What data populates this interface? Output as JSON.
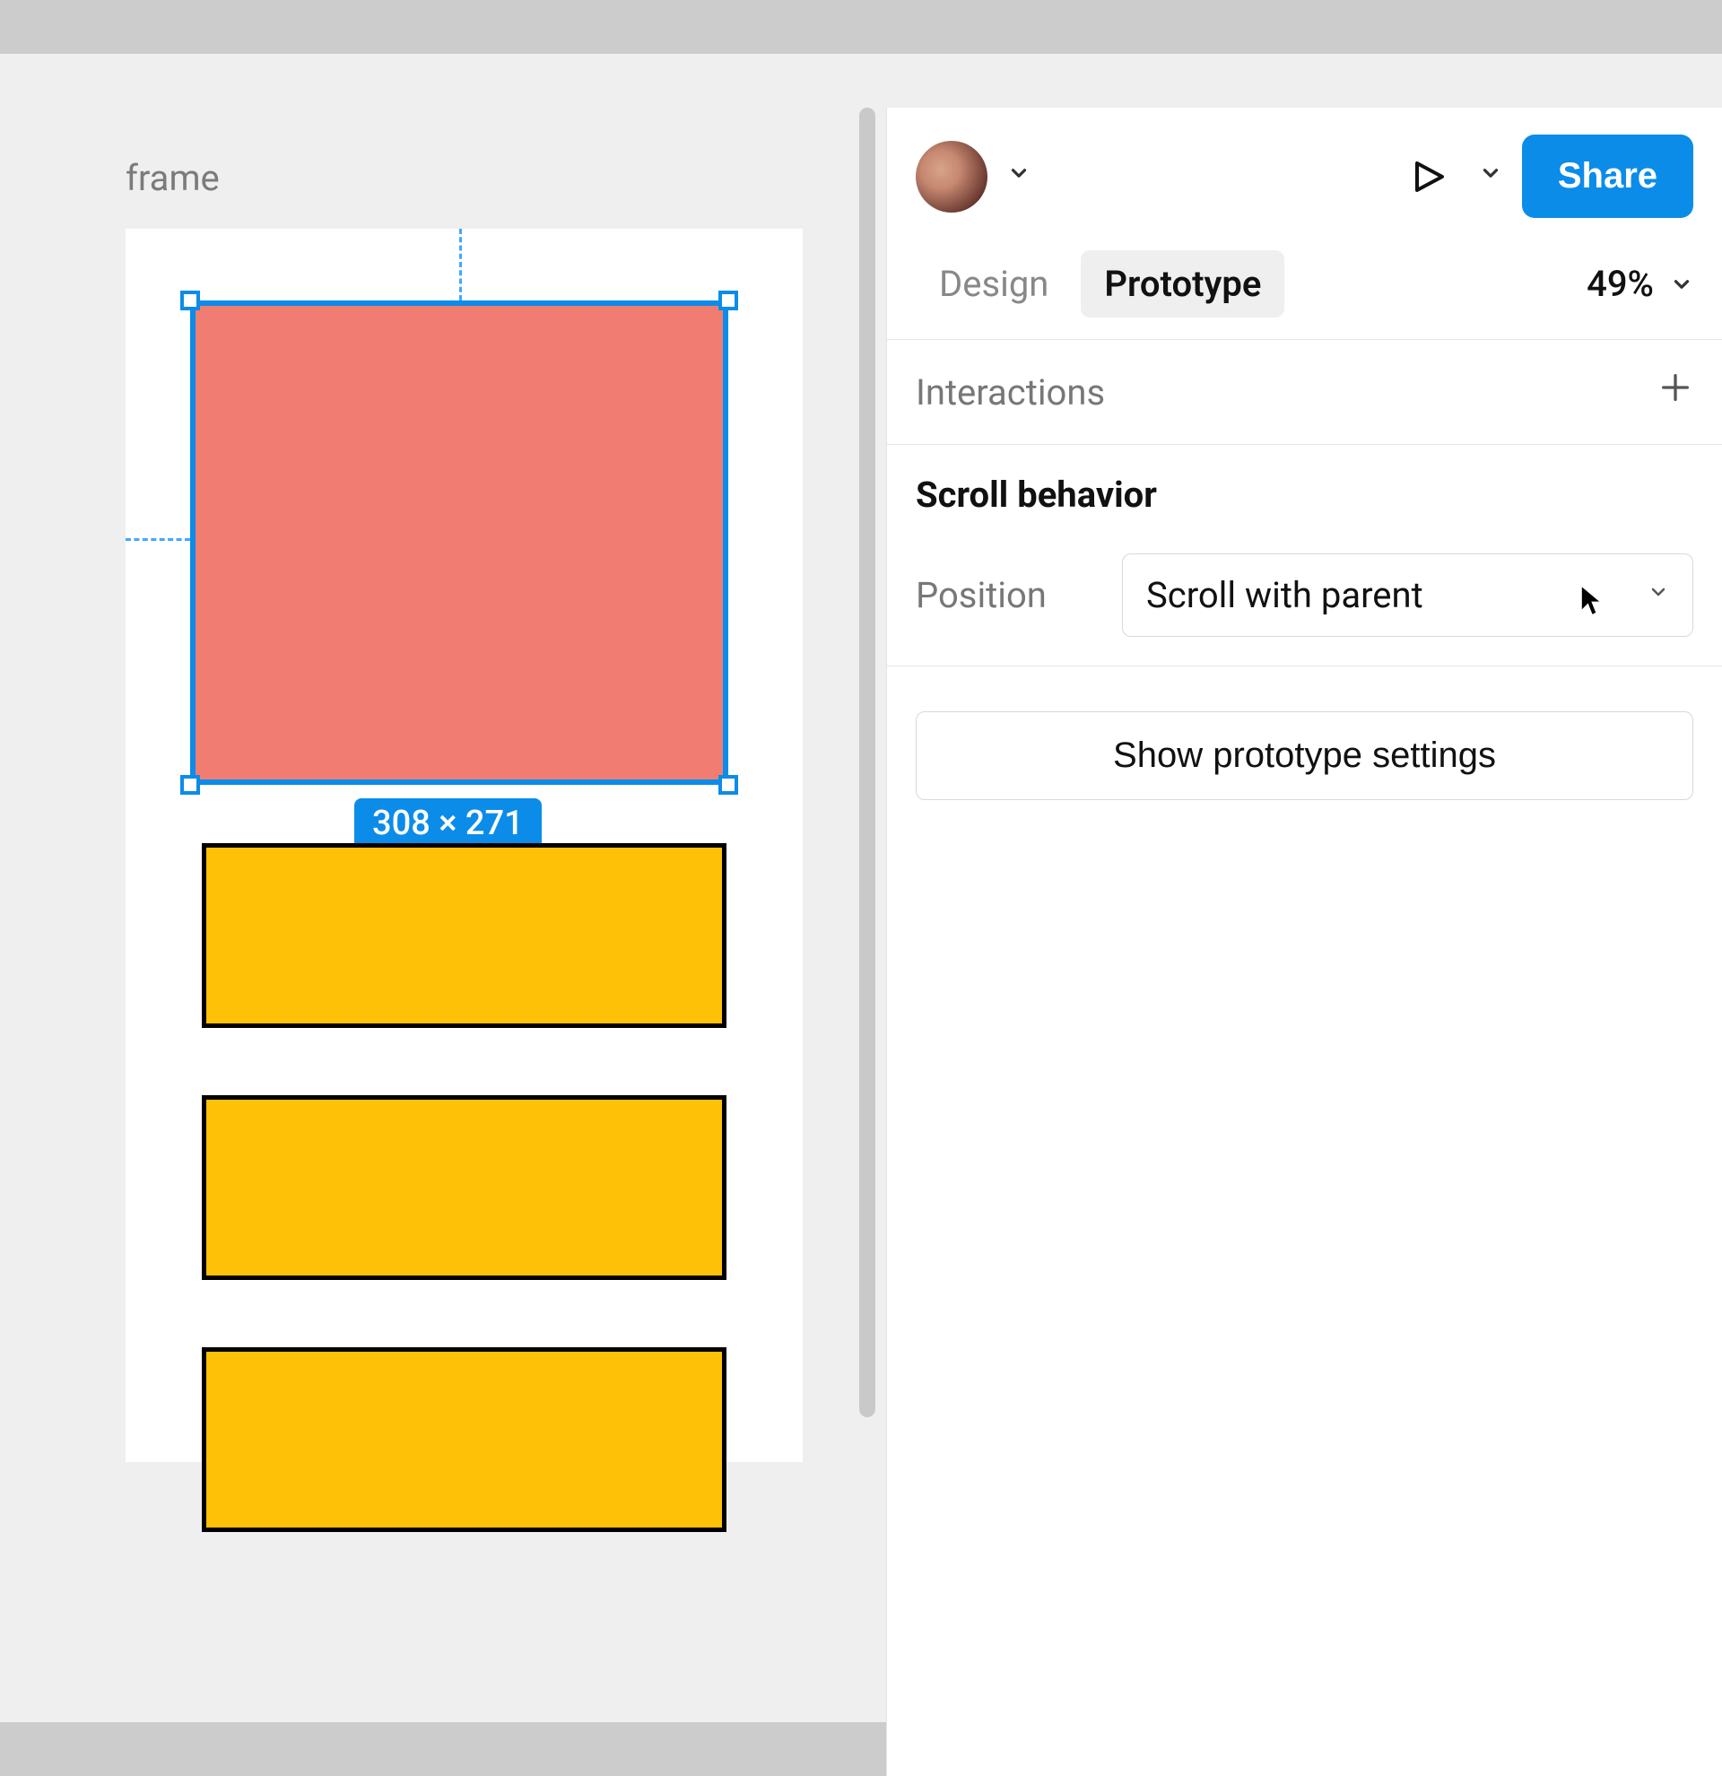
{
  "canvas": {
    "frame_label": "frame",
    "selection_dimensions": "308 × 271"
  },
  "toolbar": {
    "share_label": "Share"
  },
  "tabs": {
    "design": "Design",
    "prototype": "Prototype",
    "zoom": "49%"
  },
  "sections": {
    "interactions_title": "Interactions",
    "scroll_title": "Scroll behavior",
    "position_label": "Position",
    "position_value": "Scroll with parent",
    "settings_button": "Show prototype settings"
  }
}
